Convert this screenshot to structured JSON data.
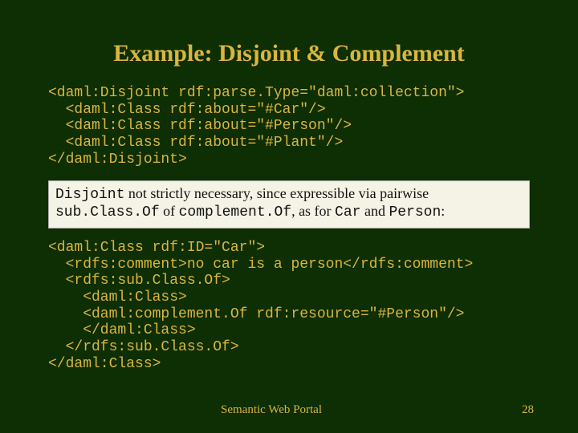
{
  "title": "Example: Disjoint & Complement",
  "code1": "<daml:Disjoint rdf:parse.Type=\"daml:collection\">\n  <daml:Class rdf:about=\"#Car\"/>\n  <daml:Class rdf:about=\"#Person\"/>\n  <daml:Class rdf:about=\"#Plant\"/>\n</daml:Disjoint>",
  "note": {
    "t1": "Disjoint",
    "t2": " not strictly necessary, since expressible via pairwise ",
    "t3": "sub.Class.Of",
    "t4": " of ",
    "t5": "complement.Of",
    "t6": ", as for ",
    "t7": "Car",
    "t8": " and ",
    "t9": "Person",
    "t10": ":"
  },
  "code2": "<daml:Class rdf:ID=\"Car\">\n  <rdfs:comment>no car is a person</rdfs:comment>\n  <rdfs:sub.Class.Of>\n    <daml:Class>\n    <daml:complement.Of rdf:resource=\"#Person\"/>\n    </daml:Class>\n  </rdfs:sub.Class.Of>\n</daml:Class>",
  "footer": "Semantic Web Portal",
  "page": "28"
}
